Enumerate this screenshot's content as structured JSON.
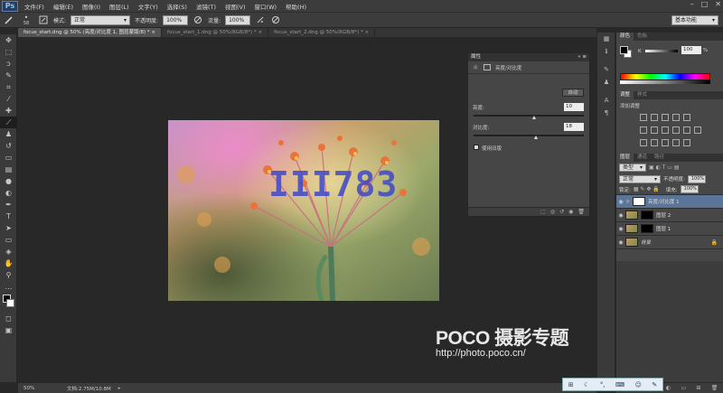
{
  "app": {
    "logo": "Ps"
  },
  "menu": [
    "文件(F)",
    "编辑(E)",
    "图像(I)",
    "图层(L)",
    "文字(Y)",
    "选择(S)",
    "滤镜(T)",
    "视图(V)",
    "窗口(W)",
    "帮助(H)"
  ],
  "window_controls": [
    "–",
    "□",
    "✕"
  ],
  "options": {
    "brush_size": "58",
    "mode_label": "模式:",
    "mode_value": "正常",
    "opacity_label": "不透明度:",
    "opacity_value": "100%",
    "flow_label": "流量:",
    "flow_value": "100%",
    "workspace": "基本功能"
  },
  "tabs": [
    "focus_start.dng @ 50% (亮度/对比度 1, 图层蒙版/8) * ×",
    "focus_start_1.dng @ 50%(RGB/8*) * ×",
    "focus_start_2.dng @ 50%(RGB/8*) * ×"
  ],
  "canvas": {
    "overlay_text": "III783",
    "poco_brand": "POCO 摄影专题",
    "poco_url": "http://photo.poco.cn/"
  },
  "status": {
    "zoom": "50%",
    "doc": "文档:2.75M/10.8M"
  },
  "properties": {
    "title": "属性",
    "panel_name": "亮度/对比度",
    "auto_button": "自动",
    "brightness_label": "亮度:",
    "brightness_value": "10",
    "brightness_level": 0.55,
    "contrast_label": "对比度:",
    "contrast_value": "18",
    "contrast_level": 0.57,
    "legacy_label": "使用旧版"
  },
  "color_panel": {
    "tabs": [
      "颜色",
      "色板"
    ],
    "channel": "K",
    "value": "100",
    "unit": "%"
  },
  "adjust_panel": {
    "tabs": [
      "调整",
      "样式"
    ],
    "add_label": "添加调整"
  },
  "layers_panel": {
    "tabs": [
      "图层",
      "通道",
      "路径"
    ],
    "filter": "类型",
    "blend": "正常",
    "opacity_label": "不透明度:",
    "opacity_value": "100%",
    "lock_label": "锁定:",
    "fill_label": "填充:",
    "fill_value": "100%",
    "layers": [
      {
        "name": "亮度/对比度 1",
        "selected": true
      },
      {
        "name": "图层 2",
        "selected": false
      },
      {
        "name": "图层 1",
        "selected": false
      },
      {
        "name": "背景",
        "selected": false
      }
    ]
  },
  "colors": {
    "accent": "#5b7597",
    "panel": "#3c3c3c"
  }
}
